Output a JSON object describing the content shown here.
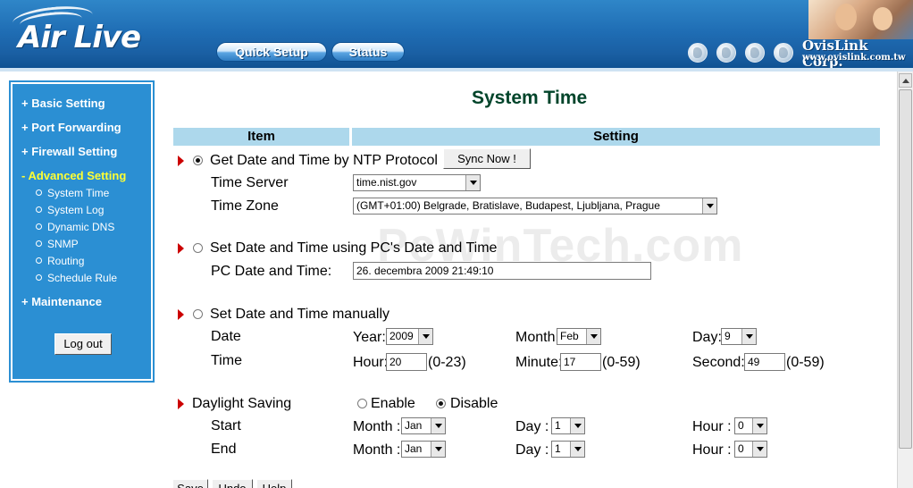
{
  "header": {
    "logo_text": "Air Live",
    "quick_setup_label": "Quick Setup",
    "status_label": "Status",
    "corp_name": "OvisLink Corp.",
    "corp_url": "www.ovislink.com.tw"
  },
  "sidebar": {
    "basic_setting": "+ Basic Setting",
    "port_forwarding": "+ Port Forwarding",
    "firewall_setting": "+ Firewall Setting",
    "advanced_setting": "- Advanced Setting",
    "sub_items": [
      "System Time",
      "System Log",
      "Dynamic DNS",
      "SNMP",
      "Routing",
      "Schedule Rule"
    ],
    "maintenance": "+ Maintenance",
    "logout_label": "Log out",
    "nav_color": "#2b8fd3",
    "active_color": "#ffff33"
  },
  "page": {
    "title": "System Time",
    "col_item": "Item",
    "col_setting": "Setting",
    "watermark": "PcWinTech.com"
  },
  "ntp": {
    "label": "Get Date and Time by NTP Protocol",
    "selected": true,
    "sync_button": "Sync Now !",
    "server_label": "Time Server",
    "server_value": "time.nist.gov",
    "zone_label": "Time Zone",
    "zone_value": "(GMT+01:00) Belgrade, Bratislave, Budapest, Ljubljana, Prague"
  },
  "pc": {
    "label": "Set Date and Time using PC's Date and Time",
    "selected": false,
    "field_label": "PC Date and Time:",
    "field_value": "26. decembra 2009 21:49:10"
  },
  "manual": {
    "label": "Set Date and Time manually",
    "selected": false,
    "date_label": "Date",
    "time_label": "Time",
    "year_label": "Year:",
    "year_value": "2009",
    "month_label": "Month:",
    "month_value": "Feb",
    "day_label": "Day:",
    "day_value": "9",
    "hour_label": "Hour:",
    "hour_value": "20",
    "hour_range": "(0-23)",
    "minute_label": "Minute:",
    "minute_value": "17",
    "minute_range": "(0-59)",
    "second_label": "Second:",
    "second_value": "49",
    "second_range": "(0-59)"
  },
  "dst": {
    "label": "Daylight Saving",
    "enable_label": "Enable",
    "disable_label": "Disable",
    "enabled": false,
    "start_label": "Start",
    "end_label": "End",
    "month_label": "Month :",
    "day_label": "Day :",
    "hour_label": "Hour :",
    "start_month": "Jan",
    "start_day": "1",
    "start_hour": "0",
    "end_month": "Jan",
    "end_day": "1",
    "end_hour": "0"
  },
  "actions": {
    "save_label": "Save",
    "undo_label": "Undo",
    "help_label": "Help"
  }
}
